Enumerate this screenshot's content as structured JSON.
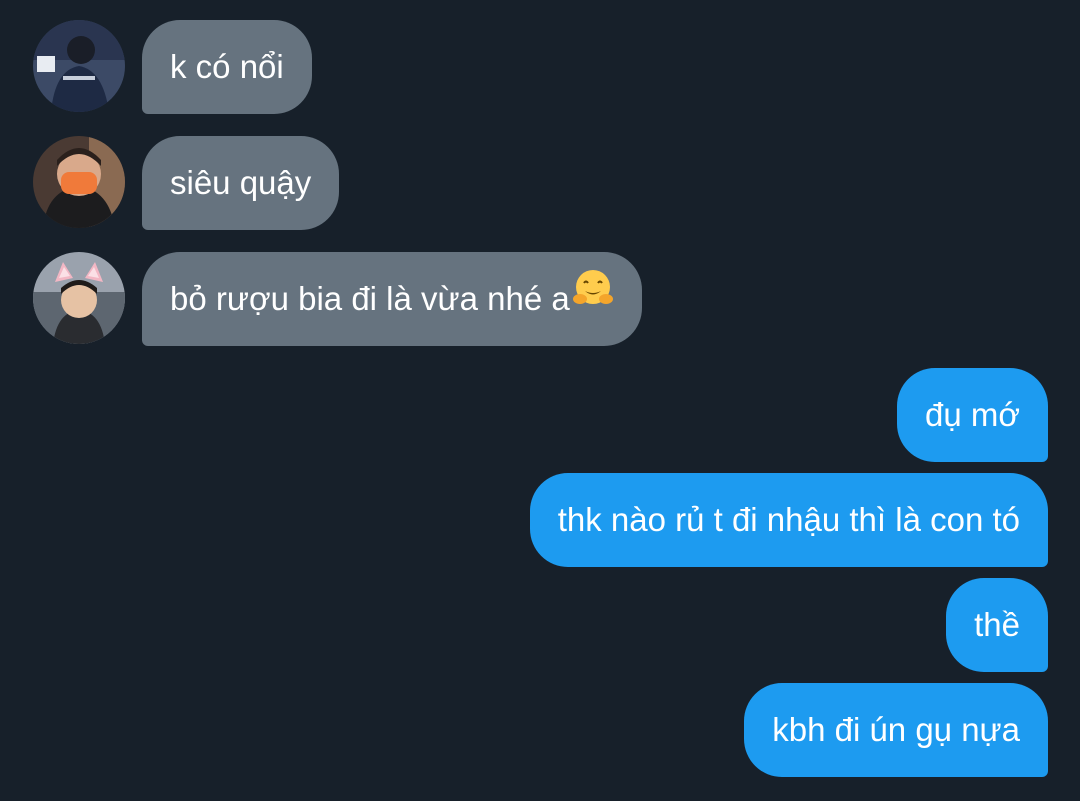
{
  "conversation": {
    "incoming": [
      {
        "avatar_icon": "avatar-photo-1",
        "text": "k có nổi"
      },
      {
        "avatar_icon": "avatar-photo-2",
        "text": "siêu quậy"
      },
      {
        "avatar_icon": "avatar-photo-3",
        "text": "bỏ rượu bia đi là vừa nhé a",
        "emoji_icon": "hugging-face-emoji"
      }
    ],
    "outgoing": [
      {
        "text": "đụ mớ"
      },
      {
        "text": "thk nào rủ t đi nhậu thì là con tó"
      },
      {
        "text": "thề"
      },
      {
        "text": "kbh đi ún gụ nựa"
      }
    ]
  },
  "colors": {
    "background": "#17202a",
    "incoming_bubble": "#66737f",
    "outgoing_bubble": "#1d9bf0",
    "text": "#ffffff"
  }
}
